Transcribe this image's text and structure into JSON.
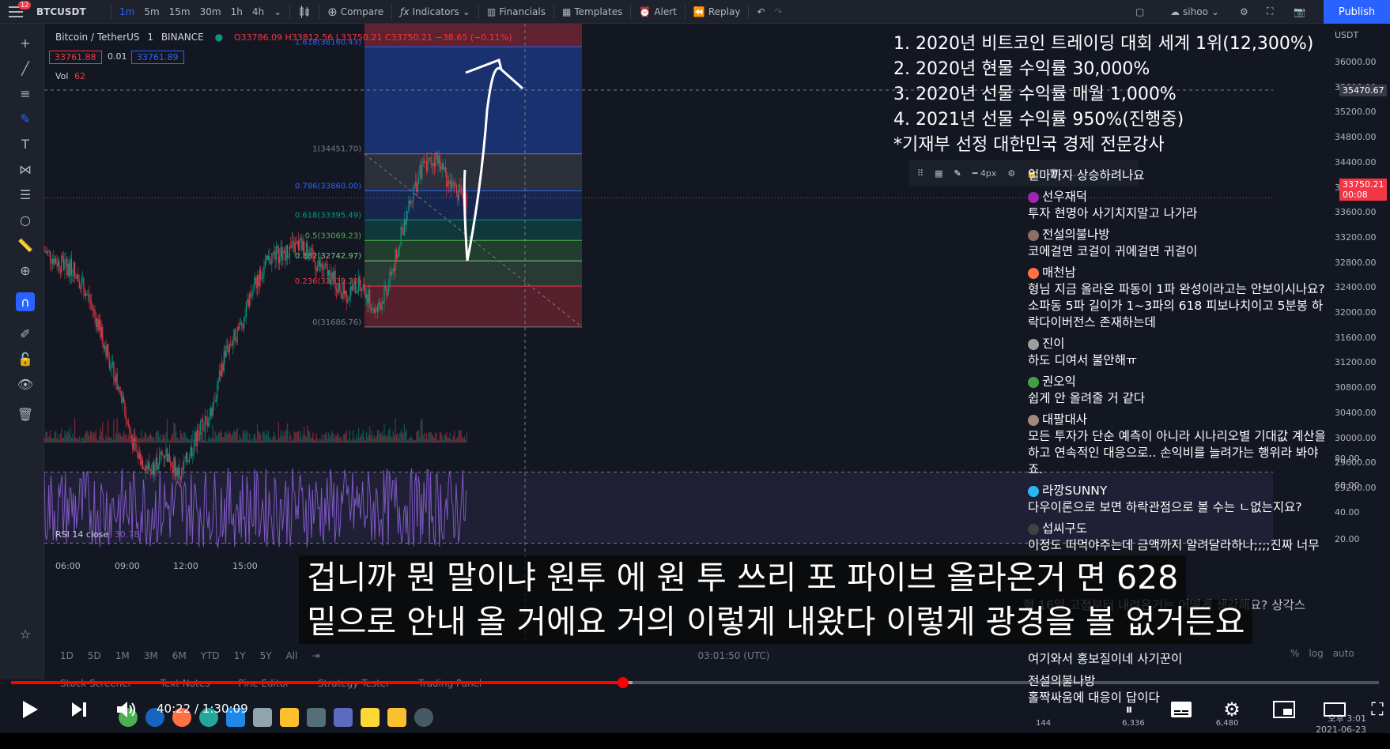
{
  "toolbar": {
    "notification_count": "12",
    "symbol": "BTCUSDT",
    "intervals": [
      "1m",
      "5m",
      "15m",
      "30m",
      "1h",
      "4h"
    ],
    "compare": "Compare",
    "indicators": "Indicators",
    "financials": "Financials",
    "templates": "Templates",
    "alert": "Alert",
    "replay": "Replay",
    "user": "sihoo",
    "publish": "Publish"
  },
  "legend": {
    "pair": "Bitcoin / TetherUS",
    "interval": "1",
    "exchange": "BINANCE",
    "ohlc": "O33786.09 H33812.56 L33750.21 C33750.21 −38.65 (−0.11%)",
    "bid": "33761.88",
    "spread": "0.01",
    "ask": "33761.89",
    "vol_label": "Vol",
    "vol_value": "62",
    "rsi_label": "RSI 14 close",
    "rsi_value": "30.78"
  },
  "fib": {
    "levels": [
      {
        "label": "1.618(36160.43)",
        "color": "#2962ff"
      },
      {
        "label": "1(34451.70)",
        "color": "#787b86"
      },
      {
        "label": "0.786(33860.00)",
        "color": "#2962ff"
      },
      {
        "label": "0.618(33395.49)",
        "color": "#089981"
      },
      {
        "label": "0.5(33069.23)",
        "color": "#4caf50"
      },
      {
        "label": "0.382(32742.97)",
        "color": "#81c784"
      },
      {
        "label": "0.236(32339.28)",
        "color": "#f23645"
      },
      {
        "label": "0(31686.76)",
        "color": "#787b86"
      }
    ]
  },
  "price_scale": {
    "ticks": [
      "36000.00",
      "35600.00",
      "35200.00",
      "34800.00",
      "34400.00",
      "34000.00",
      "33600.00",
      "33200.00",
      "32800.00",
      "32400.00",
      "32000.00",
      "31600.00",
      "31200.00",
      "30800.00",
      "30400.00",
      "30000.00",
      "29600.00",
      "29200.00"
    ],
    "rsi_ticks": [
      "80.00",
      "60.00",
      "40.00",
      "20.00"
    ],
    "crosshair_price": "35470.67",
    "last_price": "33750.21",
    "last_countdown": "00:08",
    "left_scale_tag": "USDT"
  },
  "time_axis": {
    "ticks": [
      "06:00",
      "09:00",
      "12:00",
      "15:00"
    ],
    "ranges": [
      "1D",
      "5D",
      "1M",
      "3M",
      "6M",
      "YTD",
      "1Y",
      "5Y",
      "All"
    ],
    "clock": "03:01:50 (UTC)",
    "pct": "%",
    "log": "log",
    "auto": "auto"
  },
  "bottom_tabs": [
    "Stock Screener",
    "Text Notes",
    "Pine Editor",
    "Strategy Tester",
    "Trading Panel"
  ],
  "notes": [
    "1. 2020년 비트코인 트레이딩 대회 세계 1위(12,300%)",
    "2. 2020년 현물 수익률 30,000%",
    "3. 2020년 선물 수익률 매월 1,000%",
    "4. 2021년 선물 수익률 950%(진행중)",
    "*기재부 선정 대한민국 경제 전문강사"
  ],
  "drawing_toolbar": {
    "width_label": "4px"
  },
  "chat": [
    {
      "user": "",
      "text": "얼마까지 상승하려나요",
      "color": "#888"
    },
    {
      "user": "선우재덕",
      "text": "투자 현명아 사기치지말고 나가라",
      "color": "#9c27b0"
    },
    {
      "user": "전설의불나방",
      "text": "코에걸면 코걸이 귀에걸면 귀걸이",
      "color": "#8d6e63"
    },
    {
      "user": "매천남",
      "text": "형님 지금 올라온 파동이 1파 완성이라고는 안보이시나요? 소파동 5파 길이가 1~3파의 618 피보나치이고 5분봉 하락다이버전스 존재하는데",
      "color": "#ff7043"
    },
    {
      "user": "진이",
      "text": "하도 디여서 불안해ㅠ",
      "color": "#9e9e9e"
    },
    {
      "user": "권오익",
      "text": "쉽게 안 올려줄 거 같다",
      "color": "#43a047"
    },
    {
      "user": "대팔대사",
      "text": "모든 투자가 단순 예측이 아니라 시나리오별 기대값 계산을 하고 연속적인 대응으로.. 손익비를 늘려가는 행위라 봐야죠.",
      "color": "#a1887f"
    },
    {
      "user": "라깡SUNNY",
      "text": "다우이론으로 보면 하락관점으로 볼 수는 ㄴ없는지요?",
      "color": "#29b6f6"
    },
    {
      "user": "섭씨구도",
      "text": "이정도 떠먹야주는데 금액까지 알려달라하나;;;;진짜 너무",
      "color": "#424242"
    }
  ],
  "chat_partial": [
    "형 16일 고점부터 내려온거는 어떻게 생각해요? 상각스",
    "여기와서 홍보질이네 사기꾼이"
  ],
  "chat_last": {
    "user": "전설의불나방",
    "text": "홀짝싸움에 대응이 답이다"
  },
  "subtitles": [
    "겁니까 뭔 말이냐 원투 에 원 투 쓰리 포 파이브 올라온거 면 628",
    "밑으로 안내 올 거에요 거의 이렇게 내왔다 이렇게 광경을 볼 없거든요"
  ],
  "player": {
    "time": "40:22 / 1:30:09",
    "progress": 0.4475,
    "buffered": 0.4545
  },
  "taskbar": {
    "clock_time": "오후 3:01",
    "clock_date": "2021-06-23",
    "stat_a": "6,336",
    "stat_b": "6,480",
    "stat_c": "144"
  },
  "chart_data": {
    "type": "candlestick",
    "symbol": "BTCUSDT",
    "interval": "1m",
    "price_range": [
      29200,
      36200
    ],
    "close_path": [
      32900,
      32700,
      32600,
      32100,
      31400,
      30600,
      29700,
      29400,
      29700,
      29300,
      29900,
      30300,
      31300,
      31700,
      32400,
      32800,
      32900,
      33000,
      32700,
      32500,
      32200,
      32400,
      31900,
      32500,
      33500,
      34200,
      34400,
      33900,
      33750
    ],
    "rsi_range": [
      20,
      80
    ]
  }
}
